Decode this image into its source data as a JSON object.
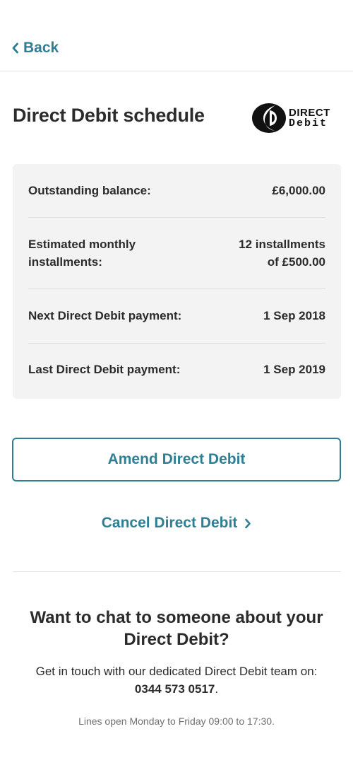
{
  "header": {
    "back_label": "Back"
  },
  "page": {
    "title": "Direct Debit schedule",
    "logo": {
      "word1": "DIRECT",
      "word2": "Debit"
    }
  },
  "schedule": {
    "rows": [
      {
        "label": "Outstanding balance:",
        "value": "£6,000.00"
      },
      {
        "label": "Estimated monthly installments:",
        "value_line1": "12 installments",
        "value_line2": "of £500.00"
      },
      {
        "label": "Next Direct Debit payment:",
        "value": "1 Sep 2018"
      },
      {
        "label": "Last Direct Debit payment:",
        "value": "1 Sep 2019"
      }
    ]
  },
  "actions": {
    "amend_label": "Amend Direct Debit",
    "cancel_label": "Cancel Direct Debit"
  },
  "help": {
    "heading": "Want to chat to someone about your Direct Debit?",
    "intro": "Get in touch with our dedicated Direct Debit team on:",
    "phone": "0344 573 0517",
    "period": ".",
    "hours": "Lines open Monday to Friday 09:00 to 17:30."
  },
  "colors": {
    "accent": "#2e7f94",
    "card_background": "#f3f3f3",
    "text": "#2b2b2b"
  }
}
